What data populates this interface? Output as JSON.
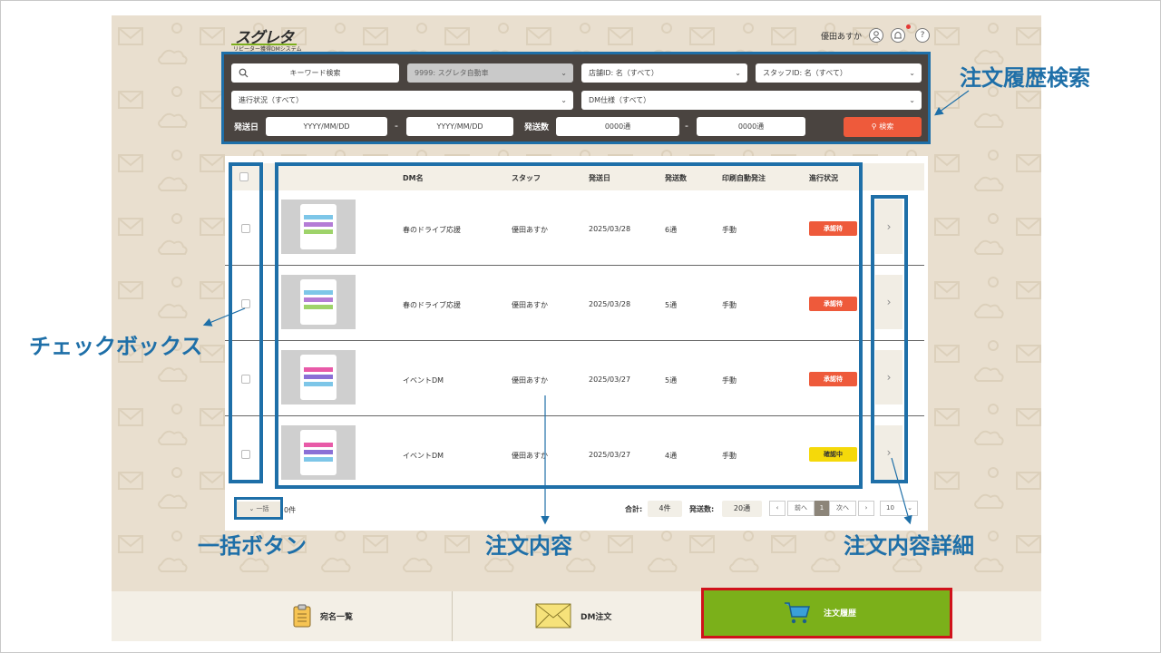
{
  "header": {
    "logo_text": "スグレタ",
    "logo_subtitle": "リピーター獲得DMシステム",
    "user_name": "優田あすか",
    "icons": [
      "user-icon",
      "bell-icon",
      "help-icon"
    ]
  },
  "search": {
    "keyword_placeholder": "キーワード検索",
    "company": "9999: スグレタ自動車",
    "store": "店舗ID: 名（すべて）",
    "staff": "スタッフID: 名（すべて）",
    "progress": "進行状況（すべて）",
    "dm_spec": "DM仕様（すべて）",
    "send_date_label": "発送日",
    "date_from": "YYYY/MM/DD",
    "date_to": "YYYY/MM/DD",
    "send_count_label": "発送数",
    "count_from": "0000通",
    "count_to": "0000通",
    "dash": "-",
    "search_button": "検索"
  },
  "table": {
    "headers": [
      "DM名",
      "スタッフ",
      "発送日",
      "発送数",
      "印刷自動発注",
      "進行状況"
    ],
    "rows": [
      {
        "dm_name": "春のドライブ応援",
        "staff": "優田あすか",
        "date": "2025/03/28",
        "count": "6通",
        "auto_order": "手動",
        "status": "承認待",
        "status_color": "#ee5a3b"
      },
      {
        "dm_name": "春のドライブ応援",
        "staff": "優田あすか",
        "date": "2025/03/28",
        "count": "5通",
        "auto_order": "手動",
        "status": "承認待",
        "status_color": "#ee5a3b"
      },
      {
        "dm_name": "イベントDM",
        "staff": "優田あすか",
        "date": "2025/03/27",
        "count": "5通",
        "auto_order": "手動",
        "status": "承認待",
        "status_color": "#ee5a3b"
      },
      {
        "dm_name": "イベントDM",
        "staff": "優田あすか",
        "date": "2025/03/27",
        "count": "4通",
        "auto_order": "手動",
        "status": "確認中",
        "status_color": "#f5d90a"
      }
    ]
  },
  "footer": {
    "bulk_button": "一括",
    "selected_count": "0件",
    "total_label": "合計:",
    "total_value": "4件",
    "sent_label": "発送数:",
    "sent_value": "20通",
    "prev": "前へ",
    "current_page": "1",
    "next": "次へ",
    "page_size": "10"
  },
  "bottom_nav": {
    "items": [
      {
        "label": "宛名一覧",
        "icon": "clipboard-icon"
      },
      {
        "label": "DM注文",
        "icon": "envelope-icon"
      },
      {
        "label": "注文履歴",
        "icon": "cart-icon",
        "active": true
      }
    ],
    "active_color": "#7bb01a"
  },
  "annotations": {
    "search": "注文履歴検索",
    "checkbox": "チェックボックス",
    "bulk": "一括ボタン",
    "content": "注文内容",
    "detail": "注文内容詳細",
    "color": "#1e6fa8"
  }
}
